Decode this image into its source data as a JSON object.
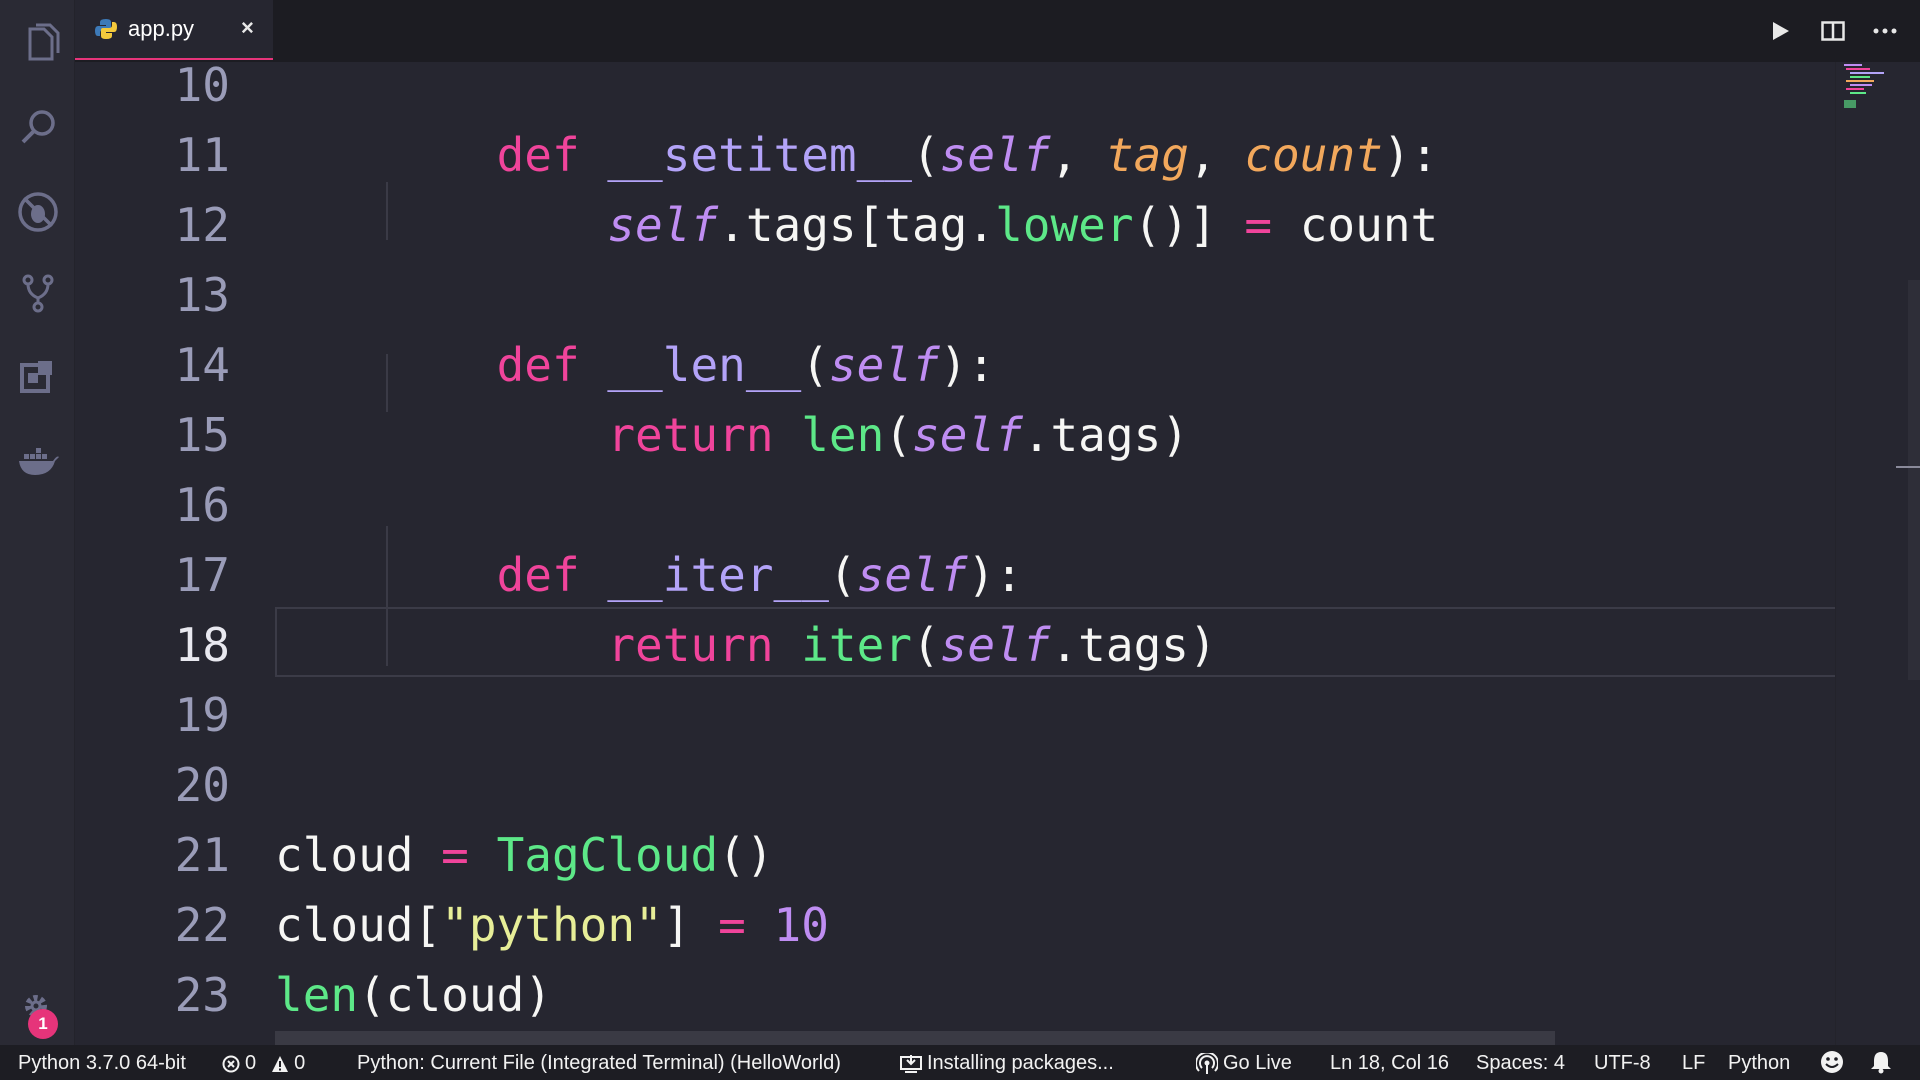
{
  "tab": {
    "label": "app.py",
    "close": "×"
  },
  "editor": {
    "lines": [
      {
        "num": "10"
      },
      {
        "num": "11"
      },
      {
        "num": "12"
      },
      {
        "num": "13"
      },
      {
        "num": "14"
      },
      {
        "num": "15"
      },
      {
        "num": "16"
      },
      {
        "num": "17"
      },
      {
        "num": "18"
      },
      {
        "num": "19"
      },
      {
        "num": "20"
      },
      {
        "num": "21"
      },
      {
        "num": "22"
      },
      {
        "num": "23"
      }
    ],
    "code": {
      "l11": {
        "def": "def",
        "name": "__setitem__",
        "open": "(",
        "self": "self",
        "c1": ", ",
        "p1": "tag",
        "c2": ", ",
        "p2": "count",
        "close": "):"
      },
      "l12": {
        "self": "self",
        "a": ".tags[tag.",
        "fn": "lower",
        "b": "()] ",
        "eq": "=",
        "c": " count"
      },
      "l14": {
        "def": "def",
        "name": "__len__",
        "open": "(",
        "self": "self",
        "close": "):"
      },
      "l15": {
        "ret": "return",
        "sp": " ",
        "fn": "len",
        "open": "(",
        "self": "self",
        "rest": ".tags)"
      },
      "l17": {
        "def": "def",
        "name": "__iter__",
        "open": "(",
        "self": "self",
        "close": "):"
      },
      "l18": {
        "ret": "return",
        "sp": " ",
        "fn": "iter",
        "open": "(",
        "self": "self",
        "rest": ".tags)"
      },
      "l21": {
        "a": "cloud ",
        "eq": "=",
        "sp": " ",
        "fn": "TagCloud",
        "b": "()"
      },
      "l22": {
        "a": "cloud[",
        "str": "\"python\"",
        "b": "] ",
        "eq": "=",
        "sp": " ",
        "num": "10"
      },
      "l23": {
        "fn": "len",
        "b": "(cloud)"
      }
    }
  },
  "activity": {
    "badge": "1"
  },
  "status": {
    "interpreter": "Python 3.7.0 64-bit",
    "errors": "0",
    "warnings": "0",
    "debug_config": "Python: Current File (Integrated Terminal) (HelloWorld)",
    "task": "Installing packages...",
    "live": "Go Live",
    "position": "Ln 18, Col 16",
    "spaces": "Spaces: 4",
    "encoding": "UTF-8",
    "eol": "LF",
    "language": "Python"
  },
  "colors": {
    "keyword": "#f0449b",
    "function_name": "#b3a3f8",
    "self": "#bf8df2",
    "param": "#f2a85c",
    "builtin": "#5de888",
    "string": "#e7ee98",
    "accent": "#e6347a"
  },
  "icons": [
    "files-icon",
    "search-icon",
    "debug-icon",
    "source-control-icon",
    "extensions-icon",
    "docker-icon",
    "gear-icon",
    "python-file-icon",
    "run-icon",
    "split-editor-icon",
    "more-icon",
    "error-icon",
    "warning-icon",
    "download-icon",
    "broadcast-icon",
    "smiley-icon",
    "bell-icon"
  ]
}
